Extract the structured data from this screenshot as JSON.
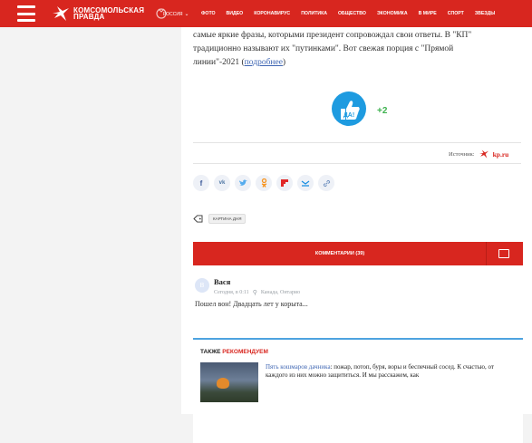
{
  "header": {
    "brand_line1": "Комсомольская",
    "brand_line2": "правда",
    "region": "РОССИЯ",
    "nav": [
      "ФОТО",
      "ВИДЕО",
      "КОРОНАВИРУС",
      "ПОЛИТИКА",
      "ОБЩЕСТВО",
      "ЭКОНОМИКА",
      "В МИРЕ",
      "СПОРТ",
      "ЗВЕЗДЫ"
    ],
    "brand_color": "#d8261f"
  },
  "article": {
    "text_line1": "самые яркие фразы, которыми президент сопровождал свои ответы. В \"КП\"",
    "text_line2": "традиционно называют их \"путинками\". Вот свежая порция с \"Прямой",
    "text_line3_prefix": "линии\"-2021 (",
    "more_link": "подробнее",
    "text_line3_suffix": ")"
  },
  "reaction": {
    "badge_text": "ДА!",
    "count": "+2"
  },
  "source": {
    "label": "Источник:",
    "site": "kp.ru"
  },
  "share_icons": [
    "facebook-icon",
    "vk-icon",
    "twitter-icon",
    "odnoklassniki-icon",
    "flipboard-icon",
    "mailru-icon",
    "link-icon"
  ],
  "tags": {
    "items": [
      "КАРТИНА ДНЯ"
    ]
  },
  "comments": {
    "label": "КОММЕНТАРИИ (39)"
  },
  "comment": {
    "avatar_letter": "В",
    "author": "Вася",
    "time": "Сегодня, в 0:11",
    "location": "Канада, Онтарио",
    "text": "Пошел вон! Двадцать лет у корыта..."
  },
  "recommend": {
    "title_black": "ТАКЖЕ ",
    "title_red": "РЕКОМЕНДУЕМ",
    "link": "Пять кошмаров дачника",
    "text": ": пожар, потоп, буря, воры и беспечный сосед. К счастью, от каждого из них можно защититься. И мы расскажем, как"
  }
}
